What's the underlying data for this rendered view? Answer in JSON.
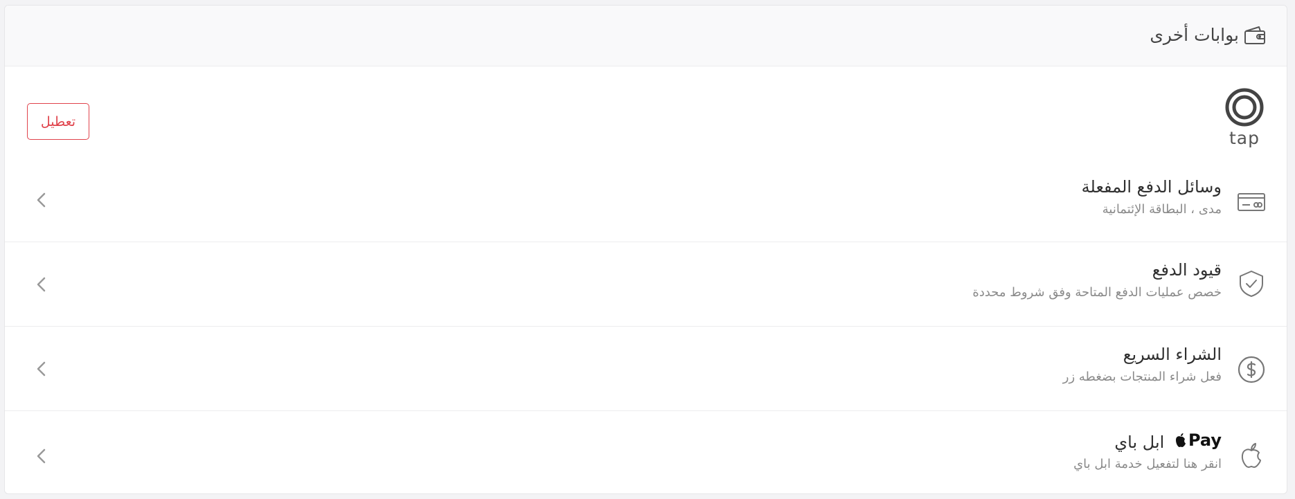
{
  "header": {
    "title": "بوابات أخرى",
    "icon": "wallet-icon"
  },
  "gateway": {
    "logo_text": "tap",
    "disable_label": "تعطيل",
    "disable_color": "#e0424b"
  },
  "rows": [
    {
      "title": "وسائل الدفع المفعلة",
      "description": "مدى ، البطاقة الإئتمانية",
      "icon": "credit-card-icon"
    },
    {
      "title": "قيود الدفع",
      "description": "خصص عمليات الدفع المتاحة وفق شروط محددة",
      "icon": "shield-check-icon"
    },
    {
      "title": "الشراء السريع",
      "description": "فعل شراء المنتجات بضغطه زر",
      "icon": "dollar-circle-icon"
    },
    {
      "title": "ابل باي",
      "brand": "Pay",
      "description": "انقر هنا لتفعيل خدمة ابل باي",
      "icon": "apple-icon"
    }
  ]
}
